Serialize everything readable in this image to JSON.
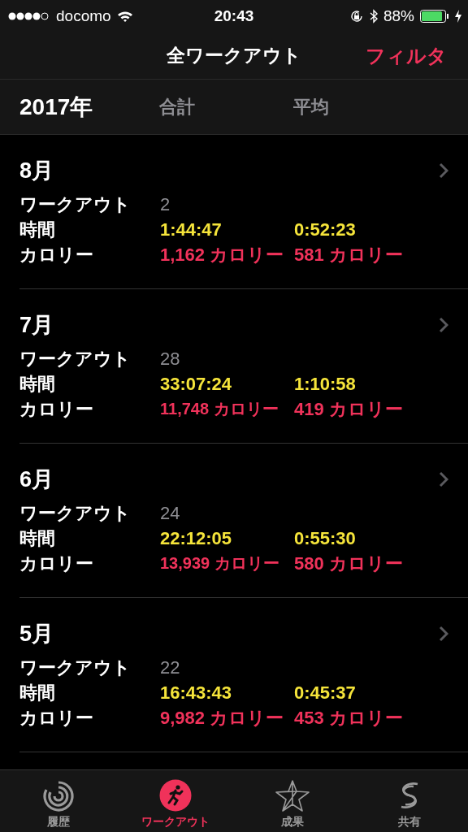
{
  "status_bar": {
    "carrier": "docomo",
    "time": "20:43",
    "battery": "88%"
  },
  "nav": {
    "title": "全ワークアウト",
    "action": "フィルタ"
  },
  "header": {
    "year": "2017年",
    "total": "合計",
    "average": "平均"
  },
  "months": [
    {
      "month": "8月",
      "workouts_label": "ワークアウト",
      "workouts": "2",
      "time_label": "時間",
      "time_total": "1:44:47",
      "time_avg": "0:52:23",
      "cal_label": "カロリー",
      "cal_total": "1,162 カロリー",
      "cal_avg": "581 カロリー"
    },
    {
      "month": "7月",
      "workouts_label": "ワークアウト",
      "workouts": "28",
      "time_label": "時間",
      "time_total": "33:07:24",
      "time_avg": "1:10:58",
      "cal_label": "カロリー",
      "cal_total": "11,748 カロリー",
      "cal_avg": "419 カロリー"
    },
    {
      "month": "6月",
      "workouts_label": "ワークアウト",
      "workouts": "24",
      "time_label": "時間",
      "time_total": "22:12:05",
      "time_avg": "0:55:30",
      "cal_label": "カロリー",
      "cal_total": "13,939 カロリー",
      "cal_avg": "580 カロリー"
    },
    {
      "month": "5月",
      "workouts_label": "ワークアウト",
      "workouts": "22",
      "time_label": "時間",
      "time_total": "16:43:43",
      "time_avg": "0:45:37",
      "cal_label": "カロリー",
      "cal_total": "9,982 カロリー",
      "cal_avg": "453 カロリー"
    }
  ],
  "tabs": [
    {
      "label": "履歴",
      "kind": "history",
      "selected": false
    },
    {
      "label": "ワークアウト",
      "kind": "workout",
      "selected": true
    },
    {
      "label": "成果",
      "kind": "awards",
      "selected": false
    },
    {
      "label": "共有",
      "kind": "sharing",
      "selected": false
    }
  ]
}
